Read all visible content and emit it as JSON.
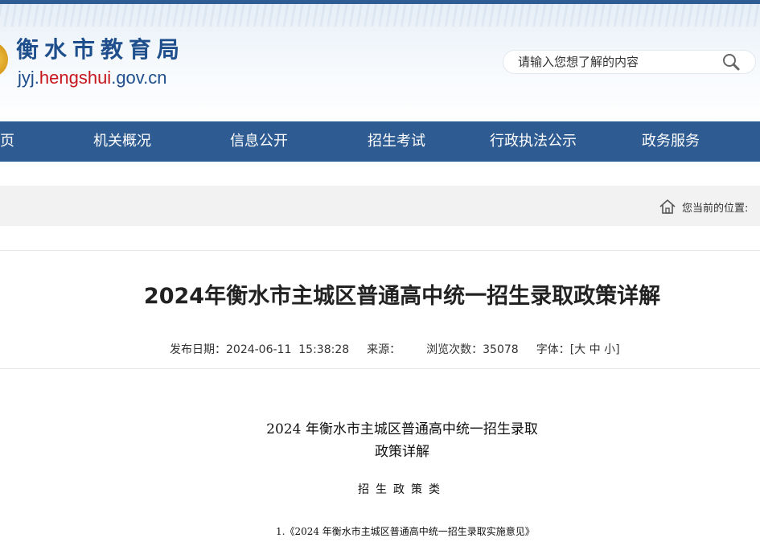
{
  "header": {
    "site_name": "衡水市教育局",
    "url_prefix": "jyj.",
    "url_accent": "hengshui",
    "url_suffix": ".gov.cn",
    "search": {
      "placeholder": "请输入您想了解的内容",
      "icon": "search-icon"
    }
  },
  "nav": {
    "items": [
      {
        "label": "首页"
      },
      {
        "label": "机关概况"
      },
      {
        "label": "信息公开"
      },
      {
        "label": "招生考试"
      },
      {
        "label": "行政执法公示"
      },
      {
        "label": "政务服务"
      }
    ]
  },
  "breadcrumb": {
    "label": "您当前的位置:",
    "icon": "home-icon"
  },
  "article": {
    "title": "2024年衡水市主城区普通高中统一招生录取政策详解",
    "meta": {
      "date_label": "发布日期：",
      "date": "2024-06-11  15:38:28",
      "source_label": "来源：",
      "source": "",
      "views_label": "浏览次数：",
      "views": "35078",
      "font_label": "字体：",
      "font_open": "[",
      "font_large": "大",
      "font_medium": "中",
      "font_small": "小",
      "font_close": "]"
    },
    "body": {
      "doc_title_line1": "2024 年衡水市主城区普通高中统一招生录取",
      "doc_title_line2": "政策详解",
      "section_heading": "招生政策类",
      "item_1": "1.《2024 年衡水市主城区普通高中统一招生录取实施意见》"
    }
  },
  "colors": {
    "nav_bg": "#2e5b92",
    "brand_blue": "#1e4f8c",
    "brand_red": "#c8161d",
    "crumb_bg": "#f2f2f2"
  }
}
